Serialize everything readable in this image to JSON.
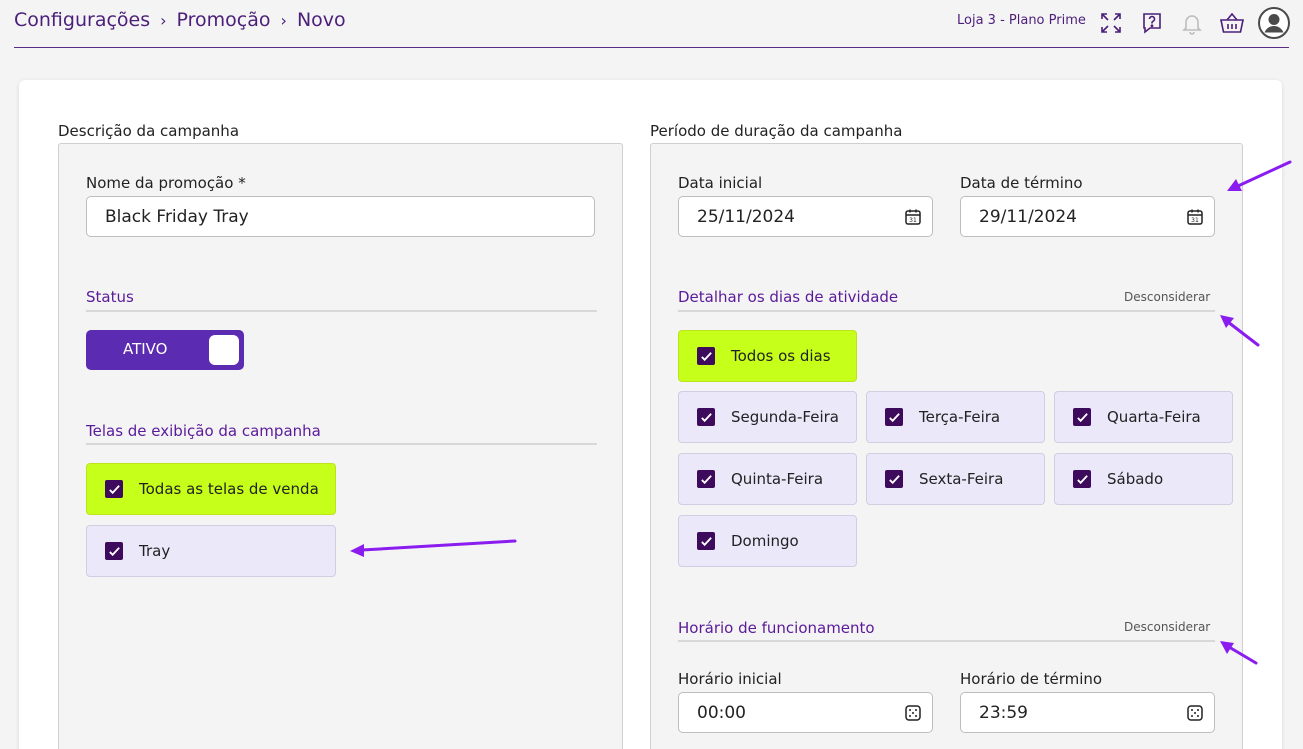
{
  "breadcrumb": {
    "items": [
      "Configurações",
      "Promoção",
      "Novo"
    ],
    "separator": "›"
  },
  "header": {
    "store_label": "Loja 3 - Plano Prime",
    "icons": [
      "expand-icon",
      "help-icon",
      "bell-icon",
      "basket-icon",
      "user-avatar-icon"
    ]
  },
  "left": {
    "section_title": "Descrição da campanha",
    "name_label": "Nome da promoção *",
    "name_value": "Black Friday Tray",
    "status_heading": "Status",
    "status_toggle": "ATIVO",
    "screens_heading": "Telas de exibição da campanha",
    "screens": [
      {
        "label": "Todas as telas de venda",
        "checked": true,
        "highlight": true
      },
      {
        "label": "Tray",
        "checked": true,
        "highlight": false
      }
    ]
  },
  "right": {
    "section_title": "Período de duração da campanha",
    "start_date_label": "Data inicial",
    "start_date_value": "25/11/2024",
    "end_date_label": "Data de término",
    "end_date_value": "29/11/2024",
    "days_heading": "Detalhar os dias de atividade",
    "days_dismiss": "Desconsiderar",
    "days": [
      {
        "label": "Todos os dias",
        "checked": true,
        "highlight": true
      },
      {
        "label": "Segunda-Feira",
        "checked": true
      },
      {
        "label": "Terça-Feira",
        "checked": true
      },
      {
        "label": "Quarta-Feira",
        "checked": true
      },
      {
        "label": "Quinta-Feira",
        "checked": true
      },
      {
        "label": "Sexta-Feira",
        "checked": true
      },
      {
        "label": "Sábado",
        "checked": true
      },
      {
        "label": "Domingo",
        "checked": true
      }
    ],
    "hours_heading": "Horário de funcionamento",
    "hours_dismiss": "Desconsiderar",
    "start_time_label": "Horário inicial",
    "start_time_value": "00:00",
    "end_time_label": "Horário de término",
    "end_time_value": "23:59"
  },
  "colors": {
    "accent": "#5b2bb2",
    "heading": "#5a1a9a",
    "lime": "#c6ff1a",
    "checkbox": "#3d0a5c",
    "arrow": "#8a1cf0"
  }
}
